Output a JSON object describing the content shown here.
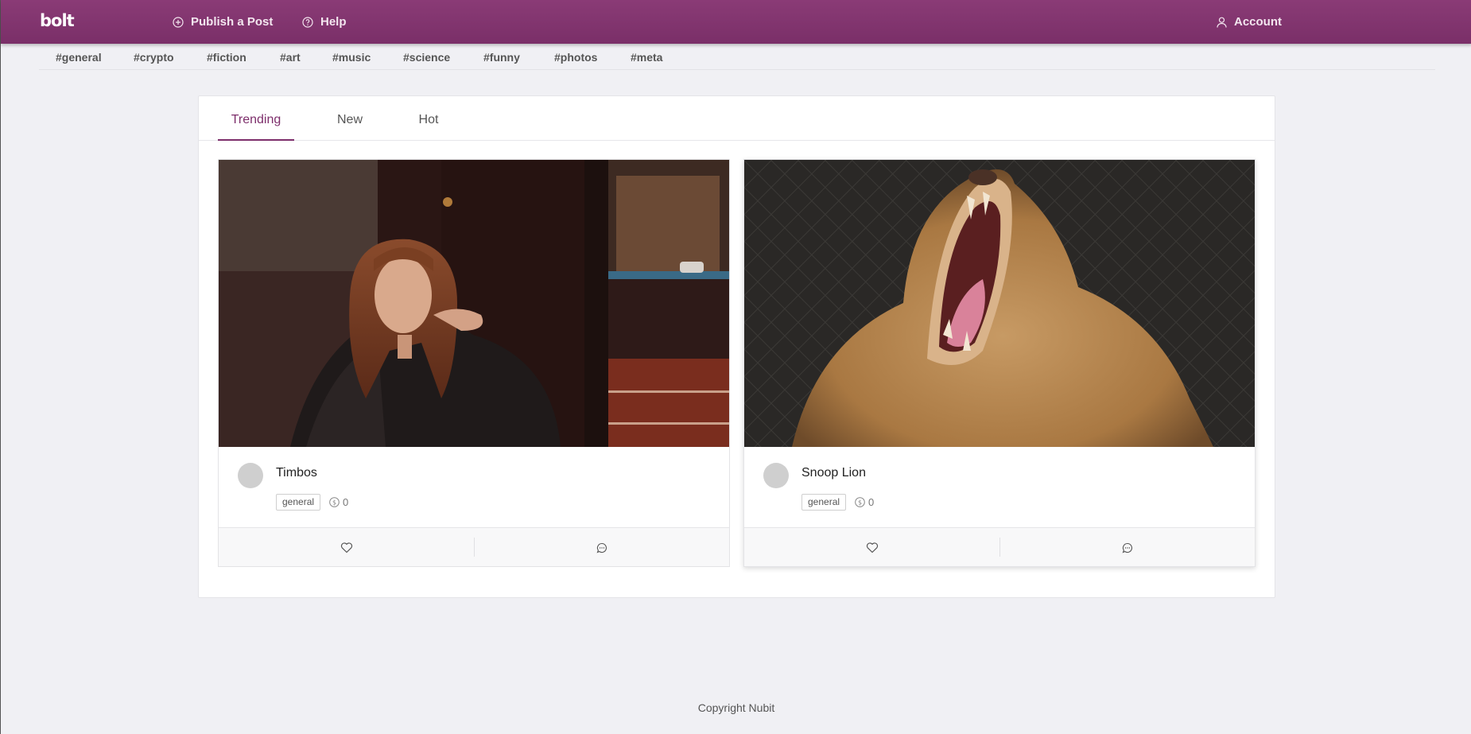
{
  "header": {
    "logo": "bolt",
    "publish_label": "Publish a Post",
    "help_label": "Help",
    "account_label": "Account"
  },
  "tags": [
    "#general",
    "#crypto",
    "#fiction",
    "#art",
    "#music",
    "#science",
    "#funny",
    "#photos",
    "#meta"
  ],
  "tabs": [
    {
      "label": "Trending",
      "active": true
    },
    {
      "label": "New",
      "active": false
    },
    {
      "label": "Hot",
      "active": false
    }
  ],
  "posts": [
    {
      "author": "Timbos",
      "category": "general",
      "reward": "0",
      "image_icon": "portrait-photo"
    },
    {
      "author": "Snoop Lion",
      "category": "general",
      "reward": "0",
      "image_icon": "lion-photo"
    }
  ],
  "footer": {
    "copyright": "Copyright Nubit"
  },
  "colors": {
    "brand": "#7d2e6b",
    "background": "#f0f0f4"
  }
}
